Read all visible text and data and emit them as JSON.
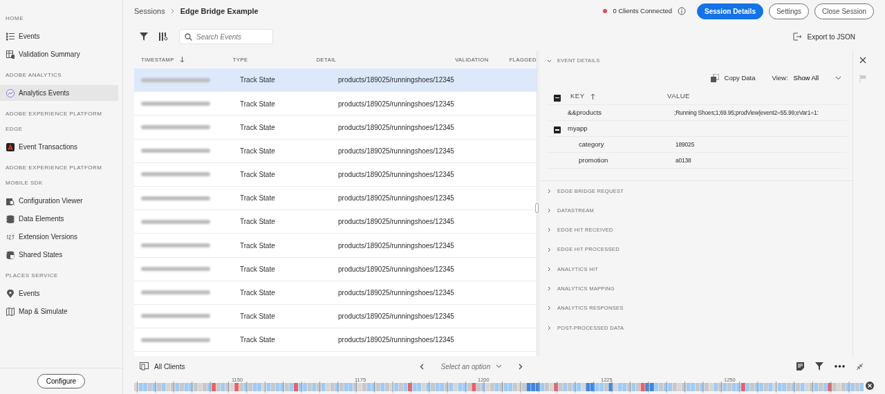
{
  "sidebar": {
    "sections": [
      {
        "title": "HOME",
        "items": [
          {
            "label": "Events",
            "selected": false
          },
          {
            "label": "Validation Summary",
            "selected": false
          }
        ]
      },
      {
        "title": "ADOBE ANALYTICS",
        "items": [
          {
            "label": "Analytics Events",
            "selected": true
          }
        ]
      },
      {
        "title": "ADOBE EXPERIENCE PLATFORM EDGE",
        "items": [
          {
            "label": "Event Transactions",
            "selected": false
          }
        ]
      },
      {
        "title": "ADOBE EXPERIENCE PLATFORM MOBILE SDK",
        "items": [
          {
            "label": "Configuration Viewer",
            "selected": false
          },
          {
            "label": "Data Elements",
            "selected": false
          },
          {
            "label": "Extension Versions",
            "selected": false
          },
          {
            "label": "Shared States",
            "selected": false
          }
        ]
      },
      {
        "title": "PLACES SERVICE",
        "items": [
          {
            "label": "Events",
            "selected": false
          },
          {
            "label": "Map & Simulate",
            "selected": false
          }
        ]
      }
    ],
    "configure_button": "Configure"
  },
  "header": {
    "breadcrumb": [
      "Sessions",
      "Edge Bridge Example"
    ],
    "status": "0 Clients Connected",
    "buttons": [
      {
        "label": "Session Details",
        "kind": "primary"
      },
      {
        "label": "Settings",
        "kind": "outline"
      },
      {
        "label": "Close Session",
        "kind": "outline"
      }
    ]
  },
  "toolbar": {
    "search": {
      "placeholder": "Search Events"
    },
    "export": "Export to JSON"
  },
  "table": {
    "columns": [
      "TIMESTAMP",
      "TYPE",
      "DETAIL",
      "VALIDATION",
      "FLAGGED"
    ],
    "rows": [
      {
        "type": "Track State",
        "detail": "products/189025/runningshoes/12345",
        "selected": true
      },
      {
        "type": "Track State",
        "detail": "products/189025/runningshoes/12345",
        "selected": false
      },
      {
        "type": "Track State",
        "detail": "products/189025/runningshoes/12345",
        "selected": false
      },
      {
        "type": "Track State",
        "detail": "products/189025/runningshoes/12345",
        "selected": false
      },
      {
        "type": "Track State",
        "detail": "products/189025/runningshoes/12345",
        "selected": false
      },
      {
        "type": "Track State",
        "detail": "products/189025/runningshoes/12345",
        "selected": false
      },
      {
        "type": "Track State",
        "detail": "products/189025/runningshoes/12345",
        "selected": false
      },
      {
        "type": "Track State",
        "detail": "products/189025/runningshoes/12345",
        "selected": false
      },
      {
        "type": "Track State",
        "detail": "products/189025/runningshoes/12345",
        "selected": false
      },
      {
        "type": "Track State",
        "detail": "products/189025/runningshoes/12345",
        "selected": false
      },
      {
        "type": "Track State",
        "detail": "products/189025/runningshoes/12345",
        "selected": false
      },
      {
        "type": "Track State",
        "detail": "products/189025/runningshoes/12345",
        "selected": false
      }
    ]
  },
  "details": {
    "title": "EVENT DETAILS",
    "expanded": true,
    "copy": "Copy Data",
    "view_label": "View:",
    "view_value": "Show All",
    "columns": [
      "KEY",
      "VALUE"
    ],
    "entries": [
      {
        "key": "&&products",
        "value": ";Running Shoes;1;69.95;prodView|event2=55.99;eVar1=1:"
      },
      {
        "key": "myapp",
        "expanded": true,
        "children": [
          {
            "key": "category",
            "value": "189025"
          },
          {
            "key": "promotion",
            "value": "a0138"
          }
        ]
      }
    ],
    "sections": [
      {
        "title": "EDGE BRIDGE REQUEST",
        "expanded": false
      },
      {
        "title": "DATASTREAM",
        "expanded": false
      },
      {
        "title": "EDGE HIT RECEIVED",
        "expanded": false
      },
      {
        "title": "EDGE HIT PROCESSED",
        "expanded": false
      },
      {
        "title": "ANALYTICS HIT",
        "expanded": false
      },
      {
        "title": "ANALYTICS MAPPING",
        "expanded": false
      },
      {
        "title": "ANALYTICS RESPONSES",
        "expanded": false
      },
      {
        "title": "POST-PROCESSED DATA",
        "expanded": false
      }
    ]
  },
  "bottom_bar": {
    "clients": "All Clients",
    "select": {
      "placeholder": "Select an option"
    }
  },
  "timeline": {
    "ticks": [
      "1150",
      "1175",
      "1200",
      "1225",
      "1250"
    ]
  }
}
